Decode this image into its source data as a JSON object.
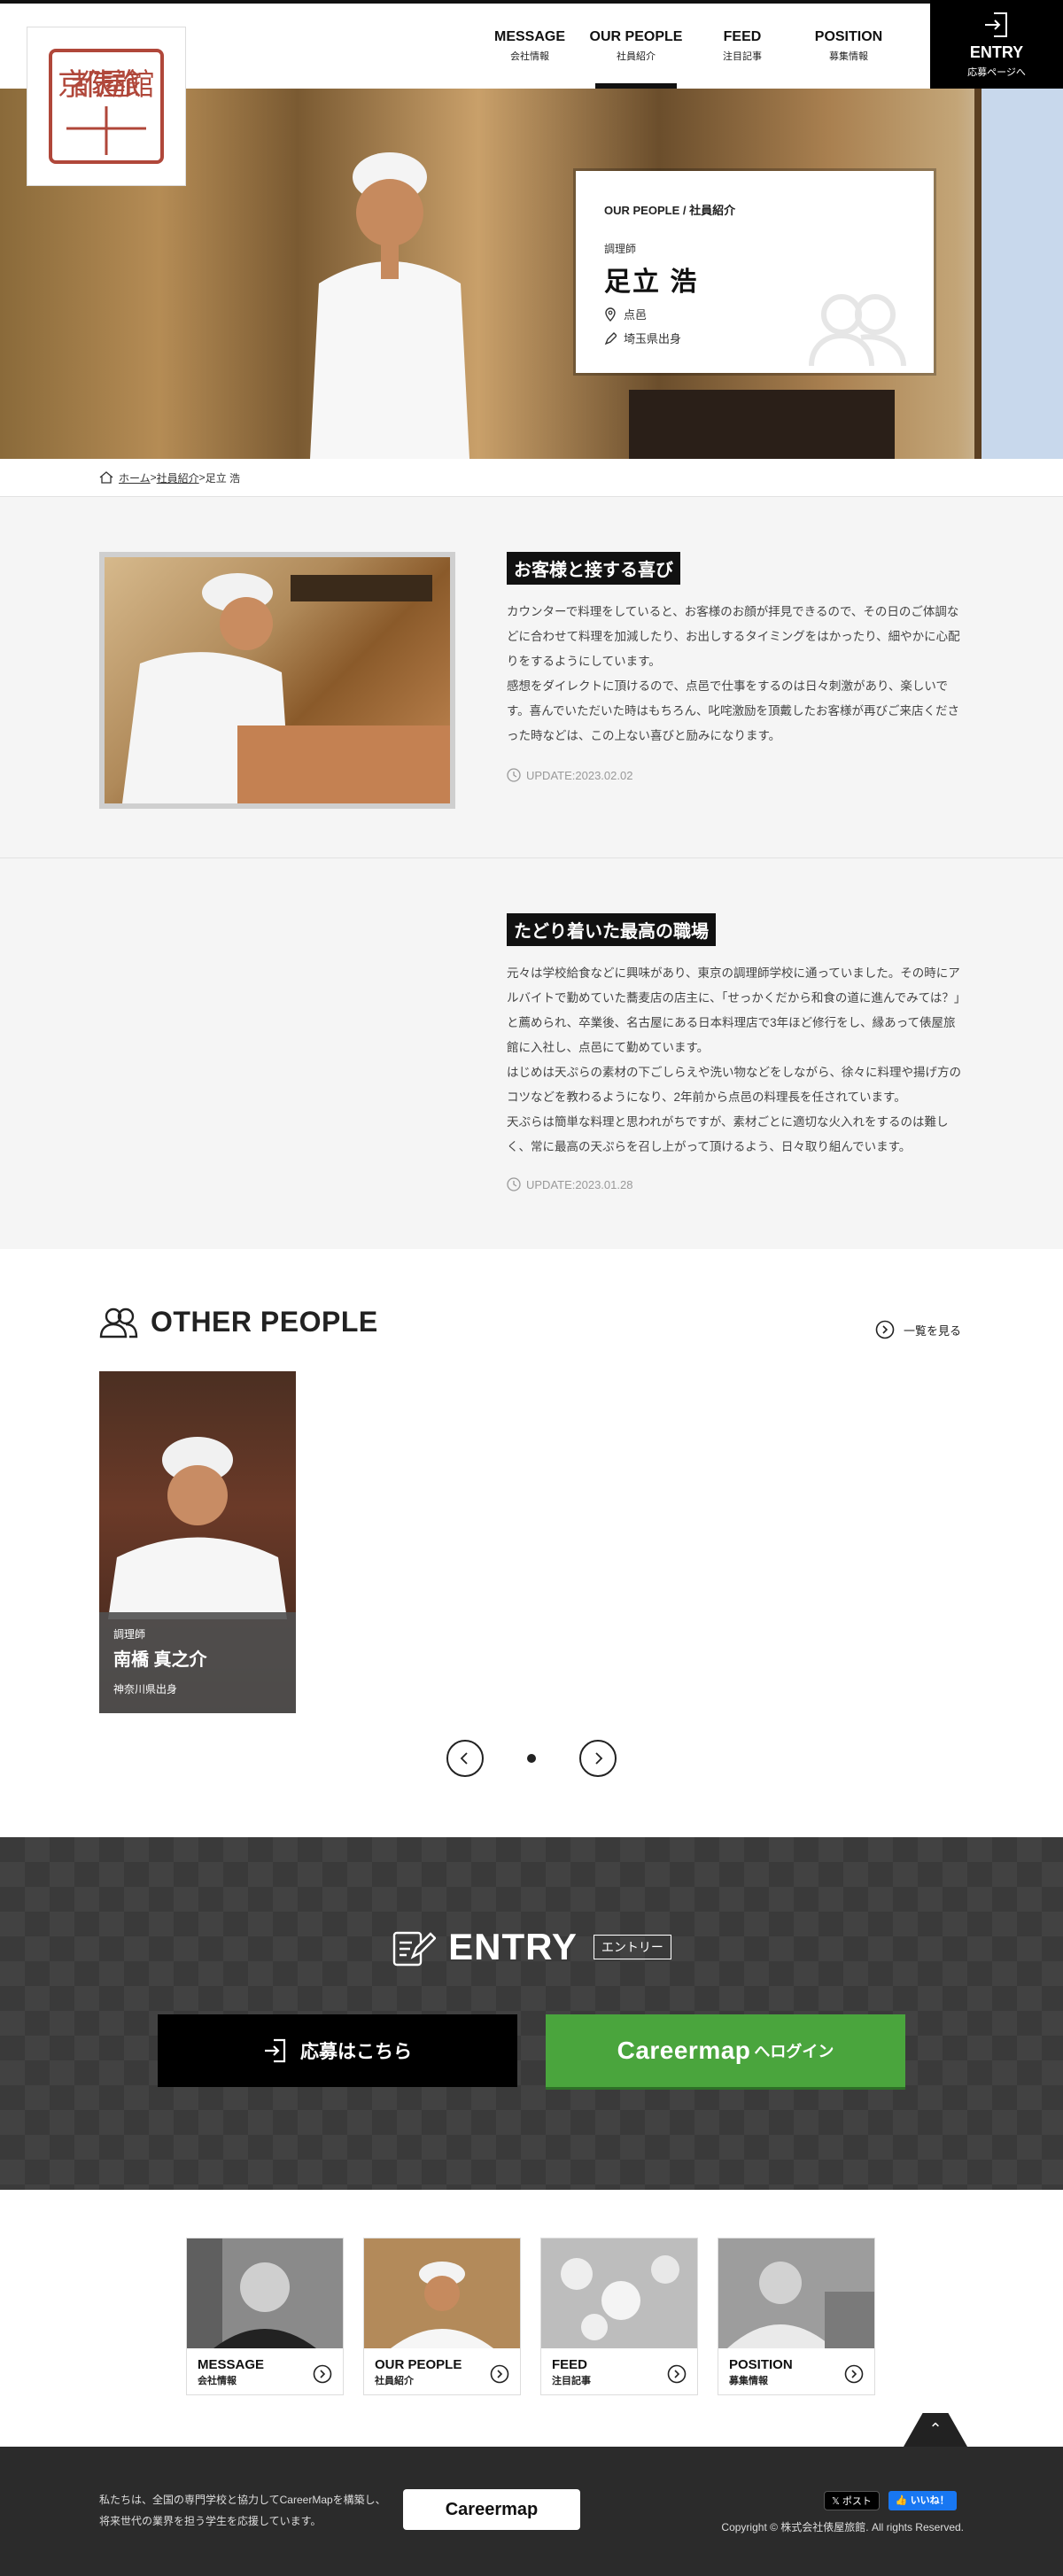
{
  "header": {
    "logo_text": "京都俵屋旅館",
    "nav": [
      {
        "en": "MESSAGE",
        "jp": "会社情報"
      },
      {
        "en": "OUR PEOPLE",
        "jp": "社員紹介"
      },
      {
        "en": "FEED",
        "jp": "注目記事"
      },
      {
        "en": "POSITION",
        "jp": "募集情報"
      }
    ],
    "entry": {
      "en": "ENTRY",
      "jp": "応募ページへ"
    }
  },
  "profile": {
    "crumb": "OUR PEOPLE / 社員紹介",
    "role": "調理師",
    "name": "足立 浩",
    "dept": "点邑",
    "origin": "埼玉県出身"
  },
  "breadcrumb": {
    "home": "ホーム",
    "sep1": " > ",
    "people": "社員紹介",
    "sep2": " > ",
    "current": "足立 浩"
  },
  "section1": {
    "heading": "お客様と接する喜び",
    "paragraphs": [
      "カウンターで料理をしていると、お客様のお顔が拝見できるので、その日のご体調などに合わせて料理を加減したり、お出しするタイミングをはかったり、細やかに心配りをするようにしています。",
      "感想をダイレクトに頂けるので、点邑で仕事をするのは日々刺激があり、楽しいです。喜んでいただいた時はもちろん、叱咤激励を頂戴したお客様が再びご来店くださった時などは、この上ない喜びと励みになります。"
    ],
    "update": "UPDATE:2023.02.02"
  },
  "section2": {
    "heading": "たどり着いた最高の職場",
    "paragraphs": [
      "元々は学校給食などに興味があり、東京の調理師学校に通っていました。その時にアルバイトで勤めていた蕎麦店の店主に、「せっかくだから和食の道に進んでみては？」と薦められ、卒業後、名古屋にある日本料理店で3年ほど修行をし、縁あって俵屋旅館に入社し、点邑にて勤めています。",
      "はじめは天ぷらの素材の下ごしらえや洗い物などをしながら、徐々に料理や揚げ方のコツなどを教わるようになり、2年前から点邑の料理長を任されています。",
      "天ぷらは簡単な料理と思われがちですが、素材ごとに適切な火入れをするのは難しく、常に最高の天ぷらを召し上がって頂けるよう、日々取り組んでいます。"
    ],
    "update": "UPDATE:2023.01.28"
  },
  "other": {
    "title": "OTHER PEOPLE",
    "see_all": "一覧を見る",
    "people": [
      {
        "role": "調理師",
        "name": "南橋 真之介",
        "origin": "神奈川県出身"
      }
    ]
  },
  "entry_section": {
    "title": "ENTRY",
    "badge": "エントリー",
    "apply": "応募はこちら",
    "careermap_brand": "Careermap",
    "careermap_sub": "へログイン"
  },
  "link_cards": [
    {
      "en": "MESSAGE",
      "jp": "会社情報"
    },
    {
      "en": "OUR PEOPLE",
      "jp": "社員紹介"
    },
    {
      "en": "FEED",
      "jp": "注目記事"
    },
    {
      "en": "POSITION",
      "jp": "募集情報"
    }
  ],
  "footer": {
    "message_line1": "私たちは、全国の専門学校と協力してCareerMapを構築し、",
    "message_line2": "将来世代の業界を担う学生を応援しています。",
    "logo": "Careermap",
    "x_label": "ポスト",
    "fb_label": "いいね！",
    "copyright": "Copyright © 株式会社俵屋旅館. All rights Reserved."
  },
  "colors": {
    "accent_green": "#4aa53d",
    "dark": "#111111",
    "seal_red": "#b0473a"
  }
}
